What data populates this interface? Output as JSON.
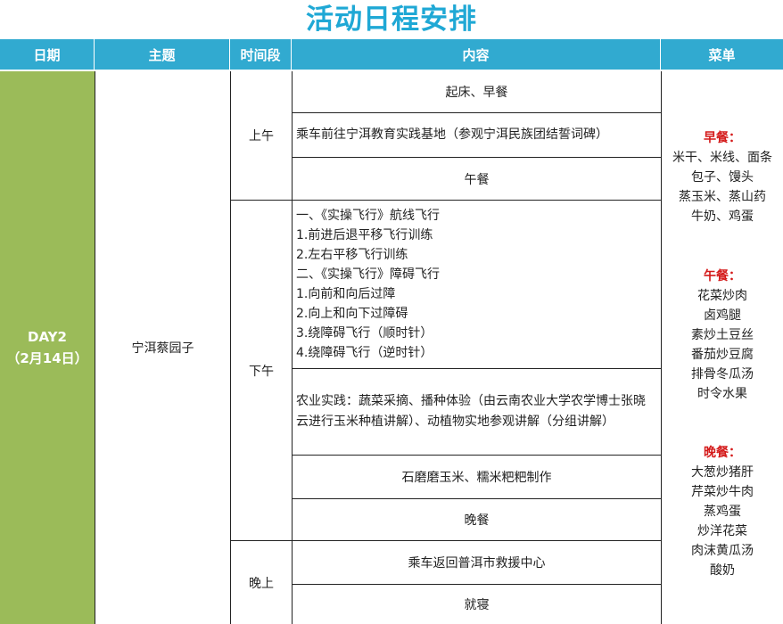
{
  "title": "活动日程安排",
  "header": {
    "date": "日期",
    "theme": "主题",
    "period": "时间段",
    "content": "内容",
    "menu": "菜单"
  },
  "day": {
    "label": "DAY2",
    "date": "（2月14日）"
  },
  "theme": "宁洱蔡园子",
  "periods": {
    "morning": "上午",
    "afternoon": "下午",
    "evening": "晚上"
  },
  "rows": {
    "r1": "起床、早餐",
    "r2": "乘车前往宁洱教育实践基地（参观宁洱民族团结誓词碑）",
    "r3": "午餐",
    "r4": [
      "一、《实操飞行》航线飞行",
      "1.前进后退平移飞行训练",
      "2.左右平移飞行训练",
      "二、《实操飞行》障碍飞行",
      "1.向前和向后过障",
      "2.向上和向下过障碍",
      "3.绕障碍飞行（顺时针）",
      "4.绕障碍飞行（逆时针）"
    ],
    "r5": "农业实践：蔬菜采摘、播种体验（由云南农业大学农学博士张晓云进行玉米种植讲解）、动植物实地参观讲解（分组讲解）",
    "r6": "石磨磨玉米、糯米粑粑制作",
    "r7": "晚餐",
    "r8": "乘车返回普洱市救援中心",
    "r9": "就寝"
  },
  "menu": {
    "breakfast": {
      "title": "早餐：",
      "items": [
        "米干、米线、面条",
        "包子、馒头",
        "蒸玉米、蒸山药",
        "牛奶、鸡蛋"
      ]
    },
    "lunch": {
      "title": "午餐：",
      "items": [
        "花菜炒肉",
        "卤鸡腿",
        "素炒土豆丝",
        "番茄炒豆腐",
        "排骨冬瓜汤",
        "时令水果"
      ]
    },
    "dinner": {
      "title": "晚餐：",
      "items": [
        "大葱炒猪肝",
        "芹菜炒牛肉",
        "蒸鸡蛋",
        "炒洋花菜",
        "肉沫黄瓜汤",
        "酸奶"
      ]
    }
  },
  "colors": {
    "title": "#1fa8d5",
    "header_bg": "#31aad0",
    "day_bg": "#9bbb59",
    "meal_title": "#d41a1a"
  }
}
